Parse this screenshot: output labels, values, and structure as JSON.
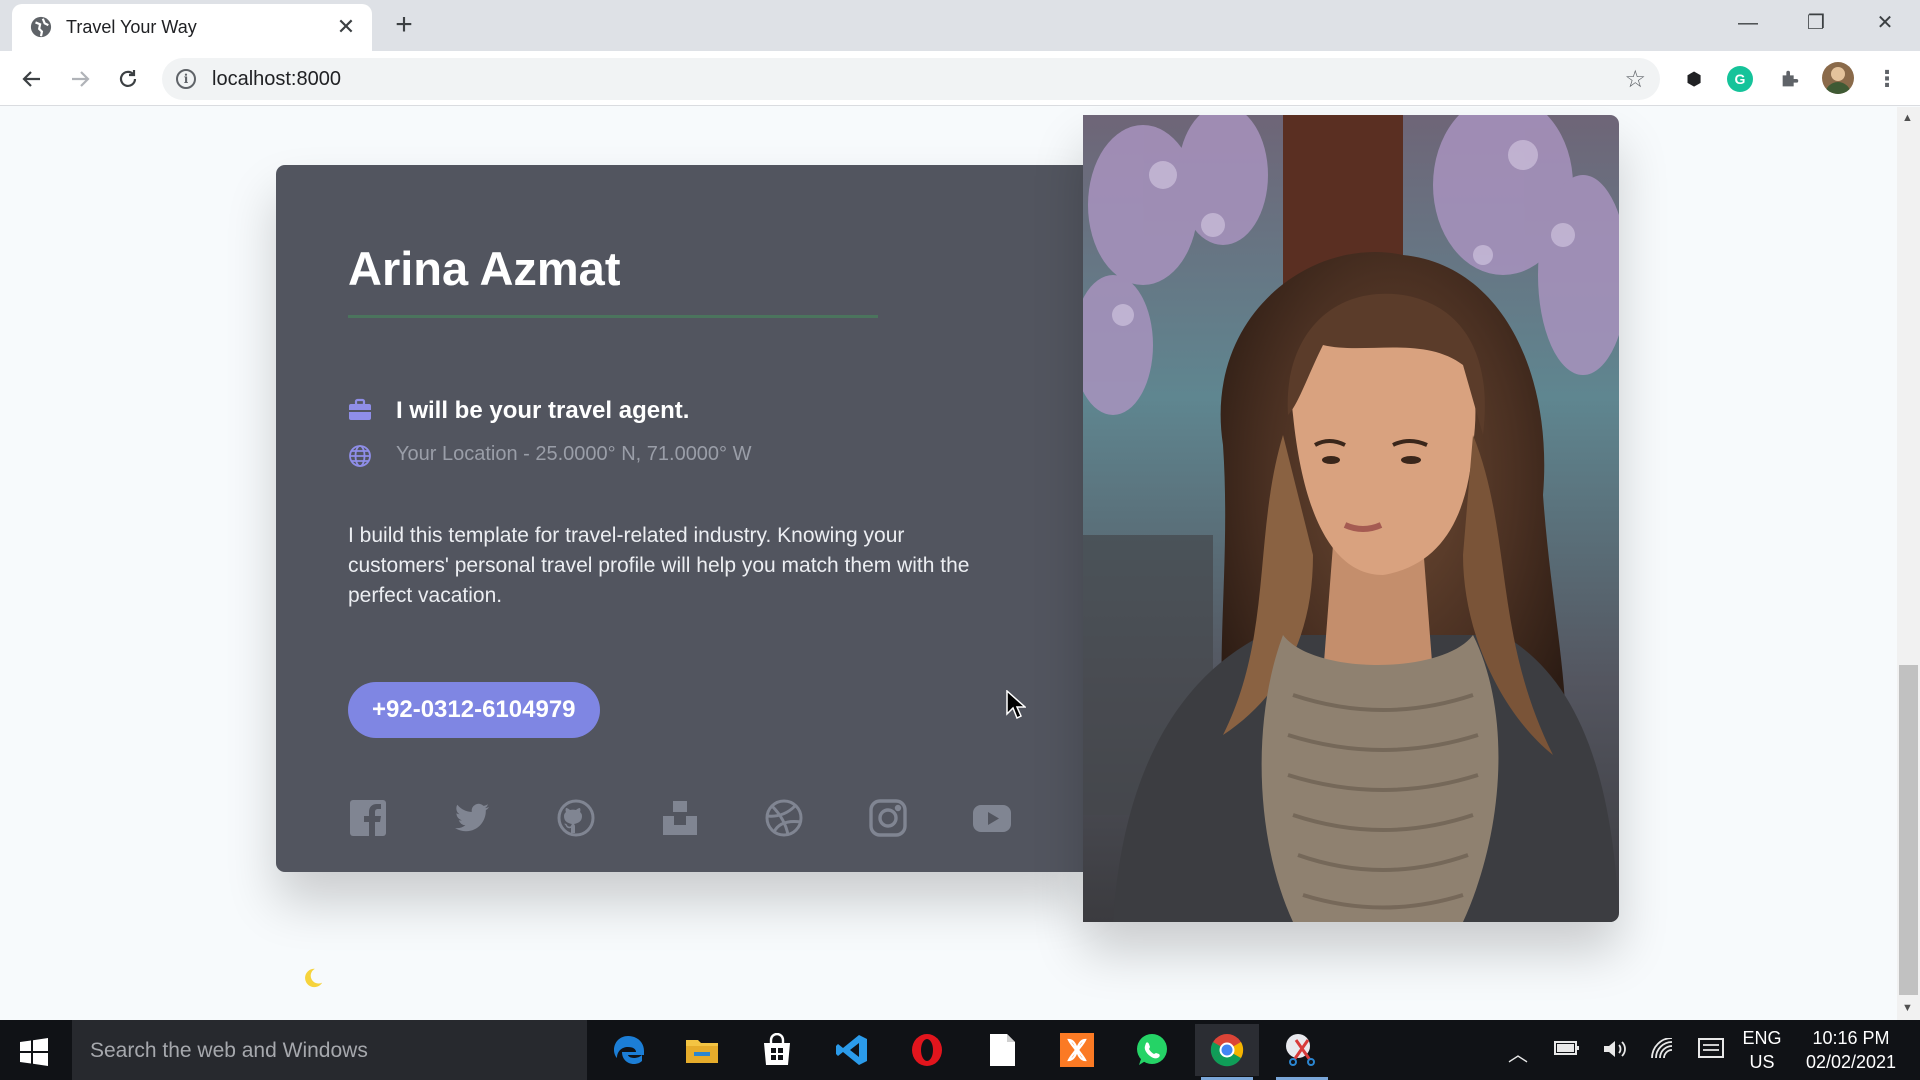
{
  "browser": {
    "tab_title": "Travel Your Way",
    "tab_close": "✕",
    "new_tab": "+",
    "url": "localhost:8000",
    "window": {
      "minimize": "—",
      "restore": "❐",
      "close": "✕"
    }
  },
  "profile": {
    "name": "Arina Azmat",
    "tagline": "I will be your travel agent.",
    "location": "Your Location - 25.0000° N, 71.0000° W",
    "bio": "I build this template for travel-related industry. Knowing your customers' personal travel profile will help you match them with the perfect vacation.",
    "phone": "+92-0312-6104979",
    "social_icons": [
      "facebook-icon",
      "twitter-icon",
      "github-icon",
      "unsplash-icon",
      "dribbble-icon",
      "instagram-icon",
      "youtube-icon"
    ]
  },
  "colors": {
    "card_bg": "#52555f",
    "accent": "#7f86e3",
    "divider": "#4a7a5d",
    "page_bg": "#f7fafc",
    "moon": "#f6d33c"
  },
  "taskbar": {
    "search_placeholder": "Search the web and Windows",
    "language": "ENG",
    "region": "US",
    "time": "10:16 PM",
    "date": "02/02/2021",
    "apps": [
      "edge-icon",
      "file-explorer-icon",
      "store-icon",
      "vscode-icon",
      "opera-icon",
      "file-icon",
      "xampp-icon",
      "whatsapp-icon",
      "chrome-icon",
      "snipping-tool-icon"
    ]
  }
}
